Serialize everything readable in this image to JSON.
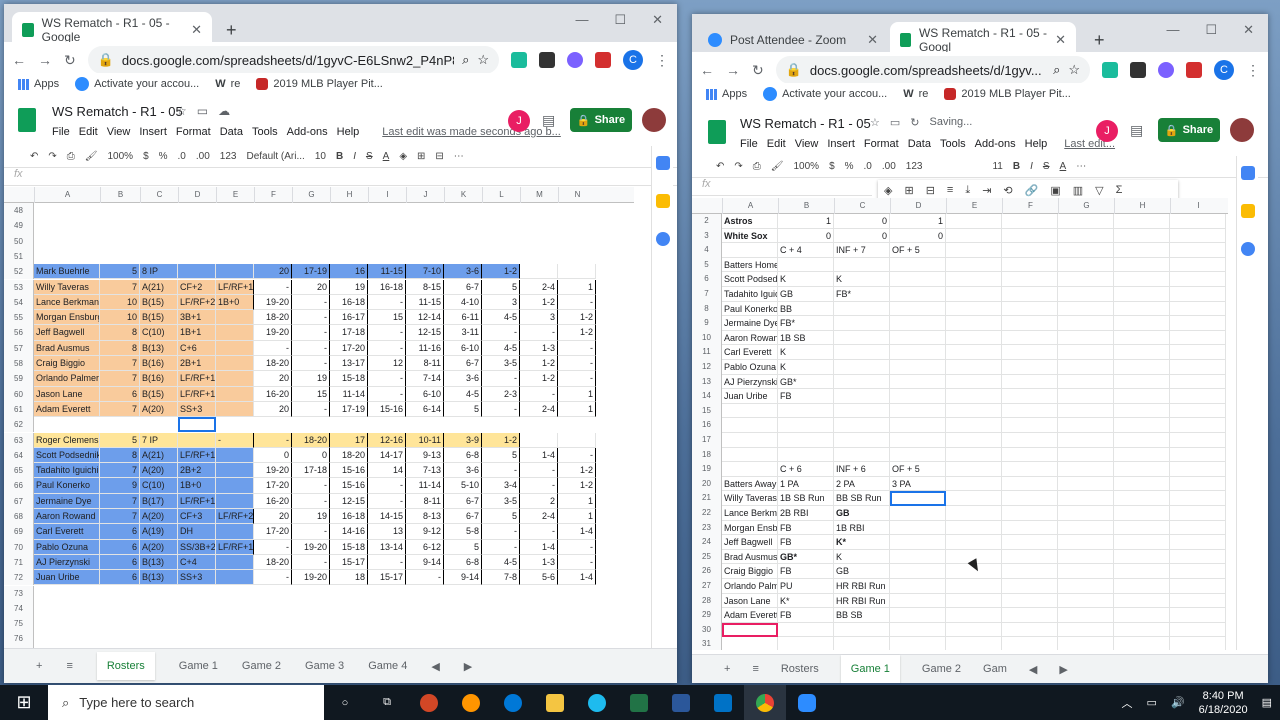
{
  "left_window": {
    "tab_title": "WS Rematch - R1 - 05 - Google",
    "new_tab": "+",
    "url": "docs.google.com/spreadsheets/d/1gyvC-E6LSnw2_P4nP8W...",
    "profile_initial": "C",
    "bookmarks": [
      "Apps",
      "Activate your accou...",
      "re",
      "2019 MLB Player Pit..."
    ],
    "doc_title": "WS Rematch - R1 - 05",
    "menus": [
      "File",
      "Edit",
      "View",
      "Insert",
      "Format",
      "Data",
      "Tools",
      "Add-ons",
      "Help"
    ],
    "last_edit": "Last edit was made seconds ago b...",
    "share_label": "Share",
    "user_initial": "J",
    "toolbar": [
      "100%",
      "$",
      "%",
      ".0",
      ".00",
      "123",
      "Default (Ari...",
      "10",
      "B",
      "I",
      "S",
      "A"
    ],
    "fx": "fx",
    "columns": [
      "A",
      "B",
      "C",
      "D",
      "E",
      "F",
      "G",
      "H",
      "I",
      "J",
      "K",
      "L",
      "M",
      "N"
    ],
    "rows": [
      {
        "n": "48",
        "cells": []
      },
      {
        "n": "49",
        "cells": []
      },
      {
        "n": "50",
        "cells": []
      },
      {
        "n": "51",
        "cells": []
      },
      {
        "n": "52",
        "cells": [
          "Mark Buehrle",
          "5",
          "8 IP",
          "",
          "",
          "20",
          "17-19",
          "16",
          "11-15",
          "7-10",
          "3-6",
          "1-2",
          "",
          ""
        ]
      },
      {
        "n": "53",
        "cells": [
          "Willy Taveras",
          "7",
          "A(21)",
          "CF+2",
          "LF/RF+1",
          "-",
          "20",
          "19",
          "16-18",
          "8-15",
          "6-7",
          "5",
          "2-4",
          "1"
        ]
      },
      {
        "n": "54",
        "cells": [
          "Lance Berkman",
          "10",
          "B(15)",
          "LF/RF+2",
          "1B+0",
          "19-20",
          "-",
          "16-18",
          "-",
          "11-15",
          "4-10",
          "3",
          "1-2",
          "-"
        ]
      },
      {
        "n": "55",
        "cells": [
          "Morgan Ensburg",
          "10",
          "B(15)",
          "3B+1",
          "",
          "18-20",
          "-",
          "16-17",
          "15",
          "12-14",
          "6-11",
          "4-5",
          "3",
          "1-2"
        ]
      },
      {
        "n": "56",
        "cells": [
          "Jeff Bagwell",
          "8",
          "C(10)",
          "1B+1",
          "",
          "19-20",
          "-",
          "17-18",
          "-",
          "12-15",
          "3-11",
          "-",
          "-",
          "1-2"
        ]
      },
      {
        "n": "57",
        "cells": [
          "Brad Ausmus",
          "8",
          "B(13)",
          "C+6",
          "",
          "-",
          "-",
          "17-20",
          "-",
          "11-16",
          "6-10",
          "4-5",
          "1-3",
          "-"
        ]
      },
      {
        "n": "58",
        "cells": [
          "Craig Biggio",
          "7",
          "B(16)",
          "2B+1",
          "",
          "18-20",
          "-",
          "13-17",
          "12",
          "8-11",
          "6-7",
          "3-5",
          "1-2",
          "-"
        ]
      },
      {
        "n": "59",
        "cells": [
          "Orlando Palmero",
          "7",
          "B(16)",
          "LF/RF+1",
          "",
          "20",
          "19",
          "15-18",
          "-",
          "7-14",
          "3-6",
          "-",
          "1-2",
          "-"
        ]
      },
      {
        "n": "60",
        "cells": [
          "Jason Lane",
          "6",
          "B(15)",
          "LF/RF+1",
          "",
          "16-20",
          "15",
          "11-14",
          "-",
          "6-10",
          "4-5",
          "2-3",
          "-",
          "1"
        ]
      },
      {
        "n": "61",
        "cells": [
          "Adam Everett",
          "7",
          "A(20)",
          "SS+3",
          "",
          "20",
          "-",
          "17-19",
          "15-16",
          "6-14",
          "5",
          "-",
          "2-4",
          "1"
        ]
      },
      {
        "n": "62",
        "cells": []
      },
      {
        "n": "63",
        "cells": [
          "Roger Clemens",
          "5",
          "7 IP",
          "",
          "-",
          "-",
          "18-20",
          "17",
          "12-16",
          "10-11",
          "3-9",
          "1-2",
          "",
          ""
        ]
      },
      {
        "n": "64",
        "cells": [
          "Scott Podsednik",
          "8",
          "A(21)",
          "LF/RF+1",
          "",
          "0",
          "0",
          "18-20",
          "14-17",
          "9-13",
          "6-8",
          "5",
          "1-4",
          "-"
        ]
      },
      {
        "n": "65",
        "cells": [
          "Tadahito Iguichi",
          "7",
          "A(20)",
          "2B+2",
          "",
          "19-20",
          "17-18",
          "15-16",
          "14",
          "7-13",
          "3-6",
          "-",
          "-",
          "1-2"
        ]
      },
      {
        "n": "66",
        "cells": [
          "Paul Konerko",
          "9",
          "C(10)",
          "1B+0",
          "",
          "17-20",
          "-",
          "15-16",
          "-",
          "11-14",
          "5-10",
          "3-4",
          "-",
          "1-2"
        ]
      },
      {
        "n": "67",
        "cells": [
          "Jermaine Dye",
          "7",
          "B(17)",
          "LF/RF+1",
          "",
          "16-20",
          "-",
          "12-15",
          "-",
          "8-11",
          "6-7",
          "3-5",
          "2",
          "1"
        ]
      },
      {
        "n": "68",
        "cells": [
          "Aaron Rowand",
          "7",
          "A(20)",
          "CF+3",
          "LF/RF+2",
          "20",
          "19",
          "16-18",
          "14-15",
          "8-13",
          "6-7",
          "5",
          "2-4",
          "1"
        ]
      },
      {
        "n": "69",
        "cells": [
          "Carl Everett",
          "6",
          "A(19)",
          "DH",
          "",
          "17-20",
          "-",
          "14-16",
          "13",
          "9-12",
          "5-8",
          "-",
          "-",
          "1-4"
        ]
      },
      {
        "n": "70",
        "cells": [
          "Pablo Ozuna",
          "6",
          "A(20)",
          "SS/3B+2",
          "LF/RF+1",
          "-",
          "19-20",
          "15-18",
          "13-14",
          "6-12",
          "5",
          "-",
          "1-4",
          "-"
        ]
      },
      {
        "n": "71",
        "cells": [
          "AJ Pierzynski",
          "6",
          "B(13)",
          "C+4",
          "",
          "18-20",
          "-",
          "15-17",
          "-",
          "9-14",
          "6-8",
          "4-5",
          "1-3",
          "-"
        ]
      },
      {
        "n": "72",
        "cells": [
          "Juan Uribe",
          "6",
          "B(13)",
          "SS+3",
          "",
          "-",
          "19-20",
          "18",
          "15-17",
          "-",
          "9-14",
          "7-8",
          "5-6",
          "1-4"
        ]
      },
      {
        "n": "73",
        "cells": []
      },
      {
        "n": "74",
        "cells": []
      },
      {
        "n": "75",
        "cells": []
      },
      {
        "n": "76",
        "cells": []
      },
      {
        "n": "77",
        "cells": []
      }
    ],
    "sheet_tabs": [
      "Rosters",
      "Game 1",
      "Game 2",
      "Game 3",
      "Game 4"
    ]
  },
  "right_window": {
    "tab1_title": "Post Attendee - Zoom",
    "tab2_title": "WS Rematch - R1 - 05 - Googl",
    "new_tab": "+",
    "url": "docs.google.com/spreadsheets/d/1gyv...",
    "profile_initial": "C",
    "bookmarks": [
      "Apps",
      "Activate your accou...",
      "re",
      "2019 MLB Player Pit..."
    ],
    "doc_title": "WS Rematch - R1 - 05",
    "saving": "Saving...",
    "menus": [
      "File",
      "Edit",
      "View",
      "Insert",
      "Format",
      "Data",
      "Tools",
      "Add-ons",
      "Help"
    ],
    "last_edit": "Last edit...",
    "share_label": "Share",
    "user_initial": "J",
    "toolbar": [
      "100%",
      "$",
      "%",
      ".0",
      ".00",
      "123",
      "11",
      "B",
      "I",
      "S",
      "A"
    ],
    "fx": "fx",
    "columns": [
      "A",
      "B",
      "C",
      "D",
      "E",
      "F",
      "G",
      "H",
      "I"
    ],
    "rows": [
      {
        "n": "2",
        "cells": [
          "Astros",
          "1",
          "0",
          "1"
        ],
        "bold": [
          0
        ]
      },
      {
        "n": "3",
        "cells": [
          "White Sox",
          "0",
          "0",
          "0"
        ],
        "bold": [
          0
        ]
      },
      {
        "n": "4",
        "cells": [
          "",
          "C + 4",
          "INF + 7",
          "OF + 5"
        ]
      },
      {
        "n": "5",
        "cells": [
          "Batters Home",
          "",
          "",
          ""
        ]
      },
      {
        "n": "6",
        "cells": [
          "Scott Podsedn",
          "K",
          "K",
          ""
        ]
      },
      {
        "n": "7",
        "cells": [
          "Tadahito Iguic",
          "GB",
          "FB*",
          ""
        ]
      },
      {
        "n": "8",
        "cells": [
          "Paul Konerko",
          "BB",
          "",
          ""
        ]
      },
      {
        "n": "9",
        "cells": [
          "Jermaine Dye",
          "FB*",
          "",
          ""
        ]
      },
      {
        "n": "10",
        "cells": [
          "Aaron Rowand",
          "1B SB",
          "",
          ""
        ]
      },
      {
        "n": "11",
        "cells": [
          "Carl Everett",
          "K",
          "",
          ""
        ]
      },
      {
        "n": "12",
        "cells": [
          "Pablo Ozuna",
          "K",
          "",
          ""
        ]
      },
      {
        "n": "13",
        "cells": [
          "AJ Pierzynski",
          "GB*",
          "",
          ""
        ]
      },
      {
        "n": "14",
        "cells": [
          "Juan Uribe",
          "FB",
          "",
          ""
        ]
      },
      {
        "n": "15",
        "cells": []
      },
      {
        "n": "16",
        "cells": []
      },
      {
        "n": "17",
        "cells": []
      },
      {
        "n": "18",
        "cells": []
      },
      {
        "n": "19",
        "cells": [
          "",
          "C + 6",
          "INF + 6",
          "OF + 5"
        ]
      },
      {
        "n": "20",
        "cells": [
          "Batters Away",
          "1 PA",
          "2 PA",
          "3 PA"
        ]
      },
      {
        "n": "21",
        "cells": [
          "Willy Taveras",
          "1B SB Run",
          "BB SB Run",
          ""
        ]
      },
      {
        "n": "22",
        "cells": [
          "Lance Berkma",
          "2B RBI",
          "GB",
          ""
        ],
        "bold": [
          2
        ]
      },
      {
        "n": "23",
        "cells": [
          "Morgan Ensbu",
          "FB",
          "1B RBI",
          ""
        ]
      },
      {
        "n": "24",
        "cells": [
          "Jeff Bagwell",
          "FB",
          "K*",
          ""
        ],
        "bold": [
          2
        ]
      },
      {
        "n": "25",
        "cells": [
          "Brad Ausmus",
          "GB*",
          "K",
          ""
        ],
        "bold": [
          1
        ]
      },
      {
        "n": "26",
        "cells": [
          "Craig Biggio",
          "FB",
          "GB",
          ""
        ]
      },
      {
        "n": "27",
        "cells": [
          "Orlando Palme",
          "PU",
          "HR RBI Run",
          ""
        ]
      },
      {
        "n": "28",
        "cells": [
          "Jason Lane",
          "K*",
          "HR RBI Run",
          ""
        ]
      },
      {
        "n": "29",
        "cells": [
          "Adam Everett",
          "FB",
          "BB SB",
          ""
        ]
      },
      {
        "n": "30",
        "cells": []
      },
      {
        "n": "31",
        "cells": []
      },
      {
        "n": "32",
        "cells": []
      }
    ],
    "sheet_tabs": [
      "Rosters",
      "Game 1",
      "Game 2",
      "Gam"
    ]
  },
  "taskbar": {
    "search_placeholder": "Type here to search",
    "time": "8:40 PM",
    "date": "6/18/2020"
  },
  "colors": {
    "orange": "#f9cb9c",
    "blue": "#6d9eeb",
    "yellow": "#ffe599",
    "green": "#188038"
  }
}
